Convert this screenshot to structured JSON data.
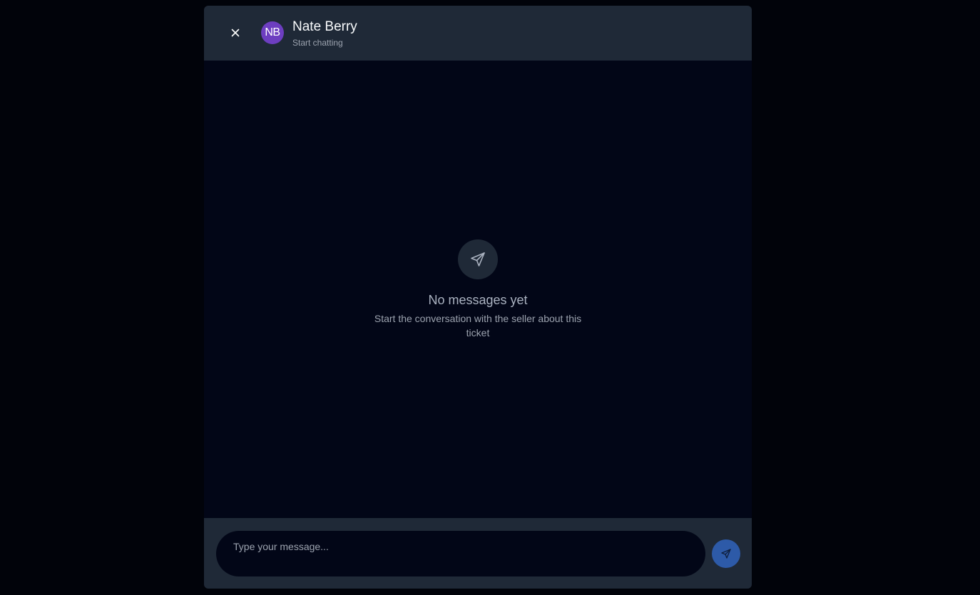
{
  "header": {
    "close_icon": "close-icon",
    "avatar_initials": "NB",
    "avatar_color": "#6d3ec0",
    "contact_name": "Nate Berry",
    "contact_status": "Start chatting"
  },
  "empty_state": {
    "icon": "send-icon",
    "title": "No messages yet",
    "subtitle": "Start the conversation with the seller about this ticket"
  },
  "composer": {
    "placeholder": "Type your message...",
    "value": "",
    "send_icon": "send-icon",
    "send_button_color": "#2d5aa8"
  },
  "colors": {
    "backdrop": "#01030a",
    "panel": "#1f2937",
    "body": "#020617"
  }
}
